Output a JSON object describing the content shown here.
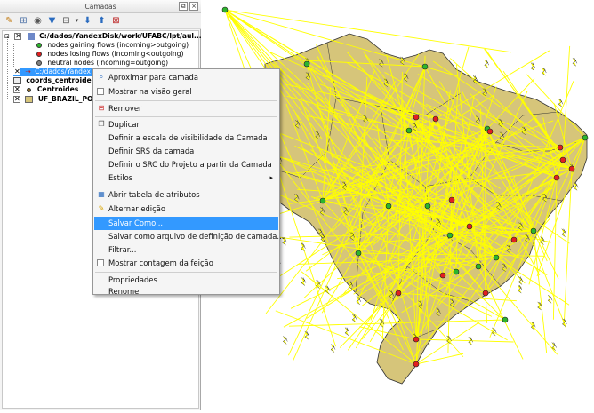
{
  "panel": {
    "title": "Camadas",
    "close_glyph": "×",
    "float_glyph": "⧉",
    "toolbar_icons": [
      "paint-style-icon",
      "add-group-icon",
      "eye-manage-icon",
      "filter-icon",
      "filter-legend-icon",
      "expand-all-icon",
      "collapse-all-icon",
      "remove-layer-icon"
    ]
  },
  "tree": {
    "group_path": "C:/dados/YandexDisk/work/UFABC/lpt/aul...",
    "legend": [
      {
        "label": "nodes gaining flows (incoming>outgoing)",
        "color": "#2db52d"
      },
      {
        "label": "nodes losing flows (incoming<outgoing)",
        "color": "#e12020"
      },
      {
        "label": "neutral nodes (incoming=outgoing)",
        "color": "#808080"
      }
    ],
    "selected_layer": "C:/dados/Yandex",
    "coords_layer": "coords_centroide",
    "centroides_layer": "Centroides",
    "ufbrazil_layer": "UF_BRAZIL_POP..."
  },
  "context_menu": {
    "items": [
      {
        "label": "Aproximar para camada",
        "icon": "zoom-layer-icon"
      },
      {
        "label": "Mostrar na visão geral",
        "icon": "overview-checkbox-icon"
      },
      {
        "label": "Remover",
        "icon": "remove-icon"
      },
      {
        "label": "Duplicar",
        "icon": "duplicate-icon"
      },
      {
        "label": "Definir a escala de visibilidade da Camada",
        "icon": ""
      },
      {
        "label": "Definir SRS da camada",
        "icon": ""
      },
      {
        "label": "Definir o SRC do Projeto a partir da Camada",
        "icon": ""
      },
      {
        "label": "Estilos",
        "icon": "",
        "submenu_glyph": "▸"
      },
      {
        "label": "Abrir tabela de atributos",
        "icon": "table-icon"
      },
      {
        "label": "Alternar edição",
        "icon": "pencil-icon"
      },
      {
        "label": "Salvar Como...",
        "icon": "",
        "highlighted": true
      },
      {
        "label": "Salvar como arquivo de definição de camada...",
        "icon": ""
      },
      {
        "label": "Filtrar...",
        "icon": ""
      },
      {
        "label": "Mostrar contagem da feição",
        "icon": "feature-count-checkbox-icon"
      },
      {
        "label": "Propriedades",
        "icon": ""
      },
      {
        "label": "Renome",
        "icon": ""
      }
    ]
  },
  "map": {
    "land_color": "#d6c57a",
    "flow_color": "#ffff00",
    "gain_color": "#2db52d",
    "loss_color": "#e12020"
  }
}
